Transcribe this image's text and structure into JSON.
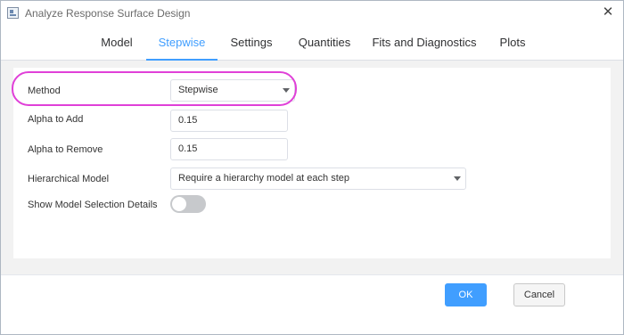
{
  "window": {
    "title": "Analyze Response Surface Design",
    "close_glyph": "✕",
    "app_icon": "dialog-icon"
  },
  "tabs": [
    {
      "label": "Model",
      "active": false
    },
    {
      "label": "Stepwise",
      "active": true
    },
    {
      "label": "Settings",
      "active": false
    },
    {
      "label": "Quantities",
      "active": false
    },
    {
      "label": "Fits and Diagnostics",
      "active": false
    },
    {
      "label": "Plots",
      "active": false
    }
  ],
  "form": {
    "method": {
      "label": "Method",
      "value": "Stepwise"
    },
    "alpha_add": {
      "label": "Alpha to Add",
      "value": "0.15"
    },
    "alpha_remove": {
      "label": "Alpha to Remove",
      "value": "0.15"
    },
    "hierarchical": {
      "label": "Hierarchical Model",
      "value": "Require a hierarchy model at each step"
    },
    "show_details": {
      "label": "Show Model Selection Details",
      "enabled": false
    }
  },
  "buttons": {
    "ok": "OK",
    "cancel": "Cancel"
  },
  "colors": {
    "accent": "#409eff",
    "highlight": "#e040d8",
    "toggle_off": "#c7c9cc"
  }
}
